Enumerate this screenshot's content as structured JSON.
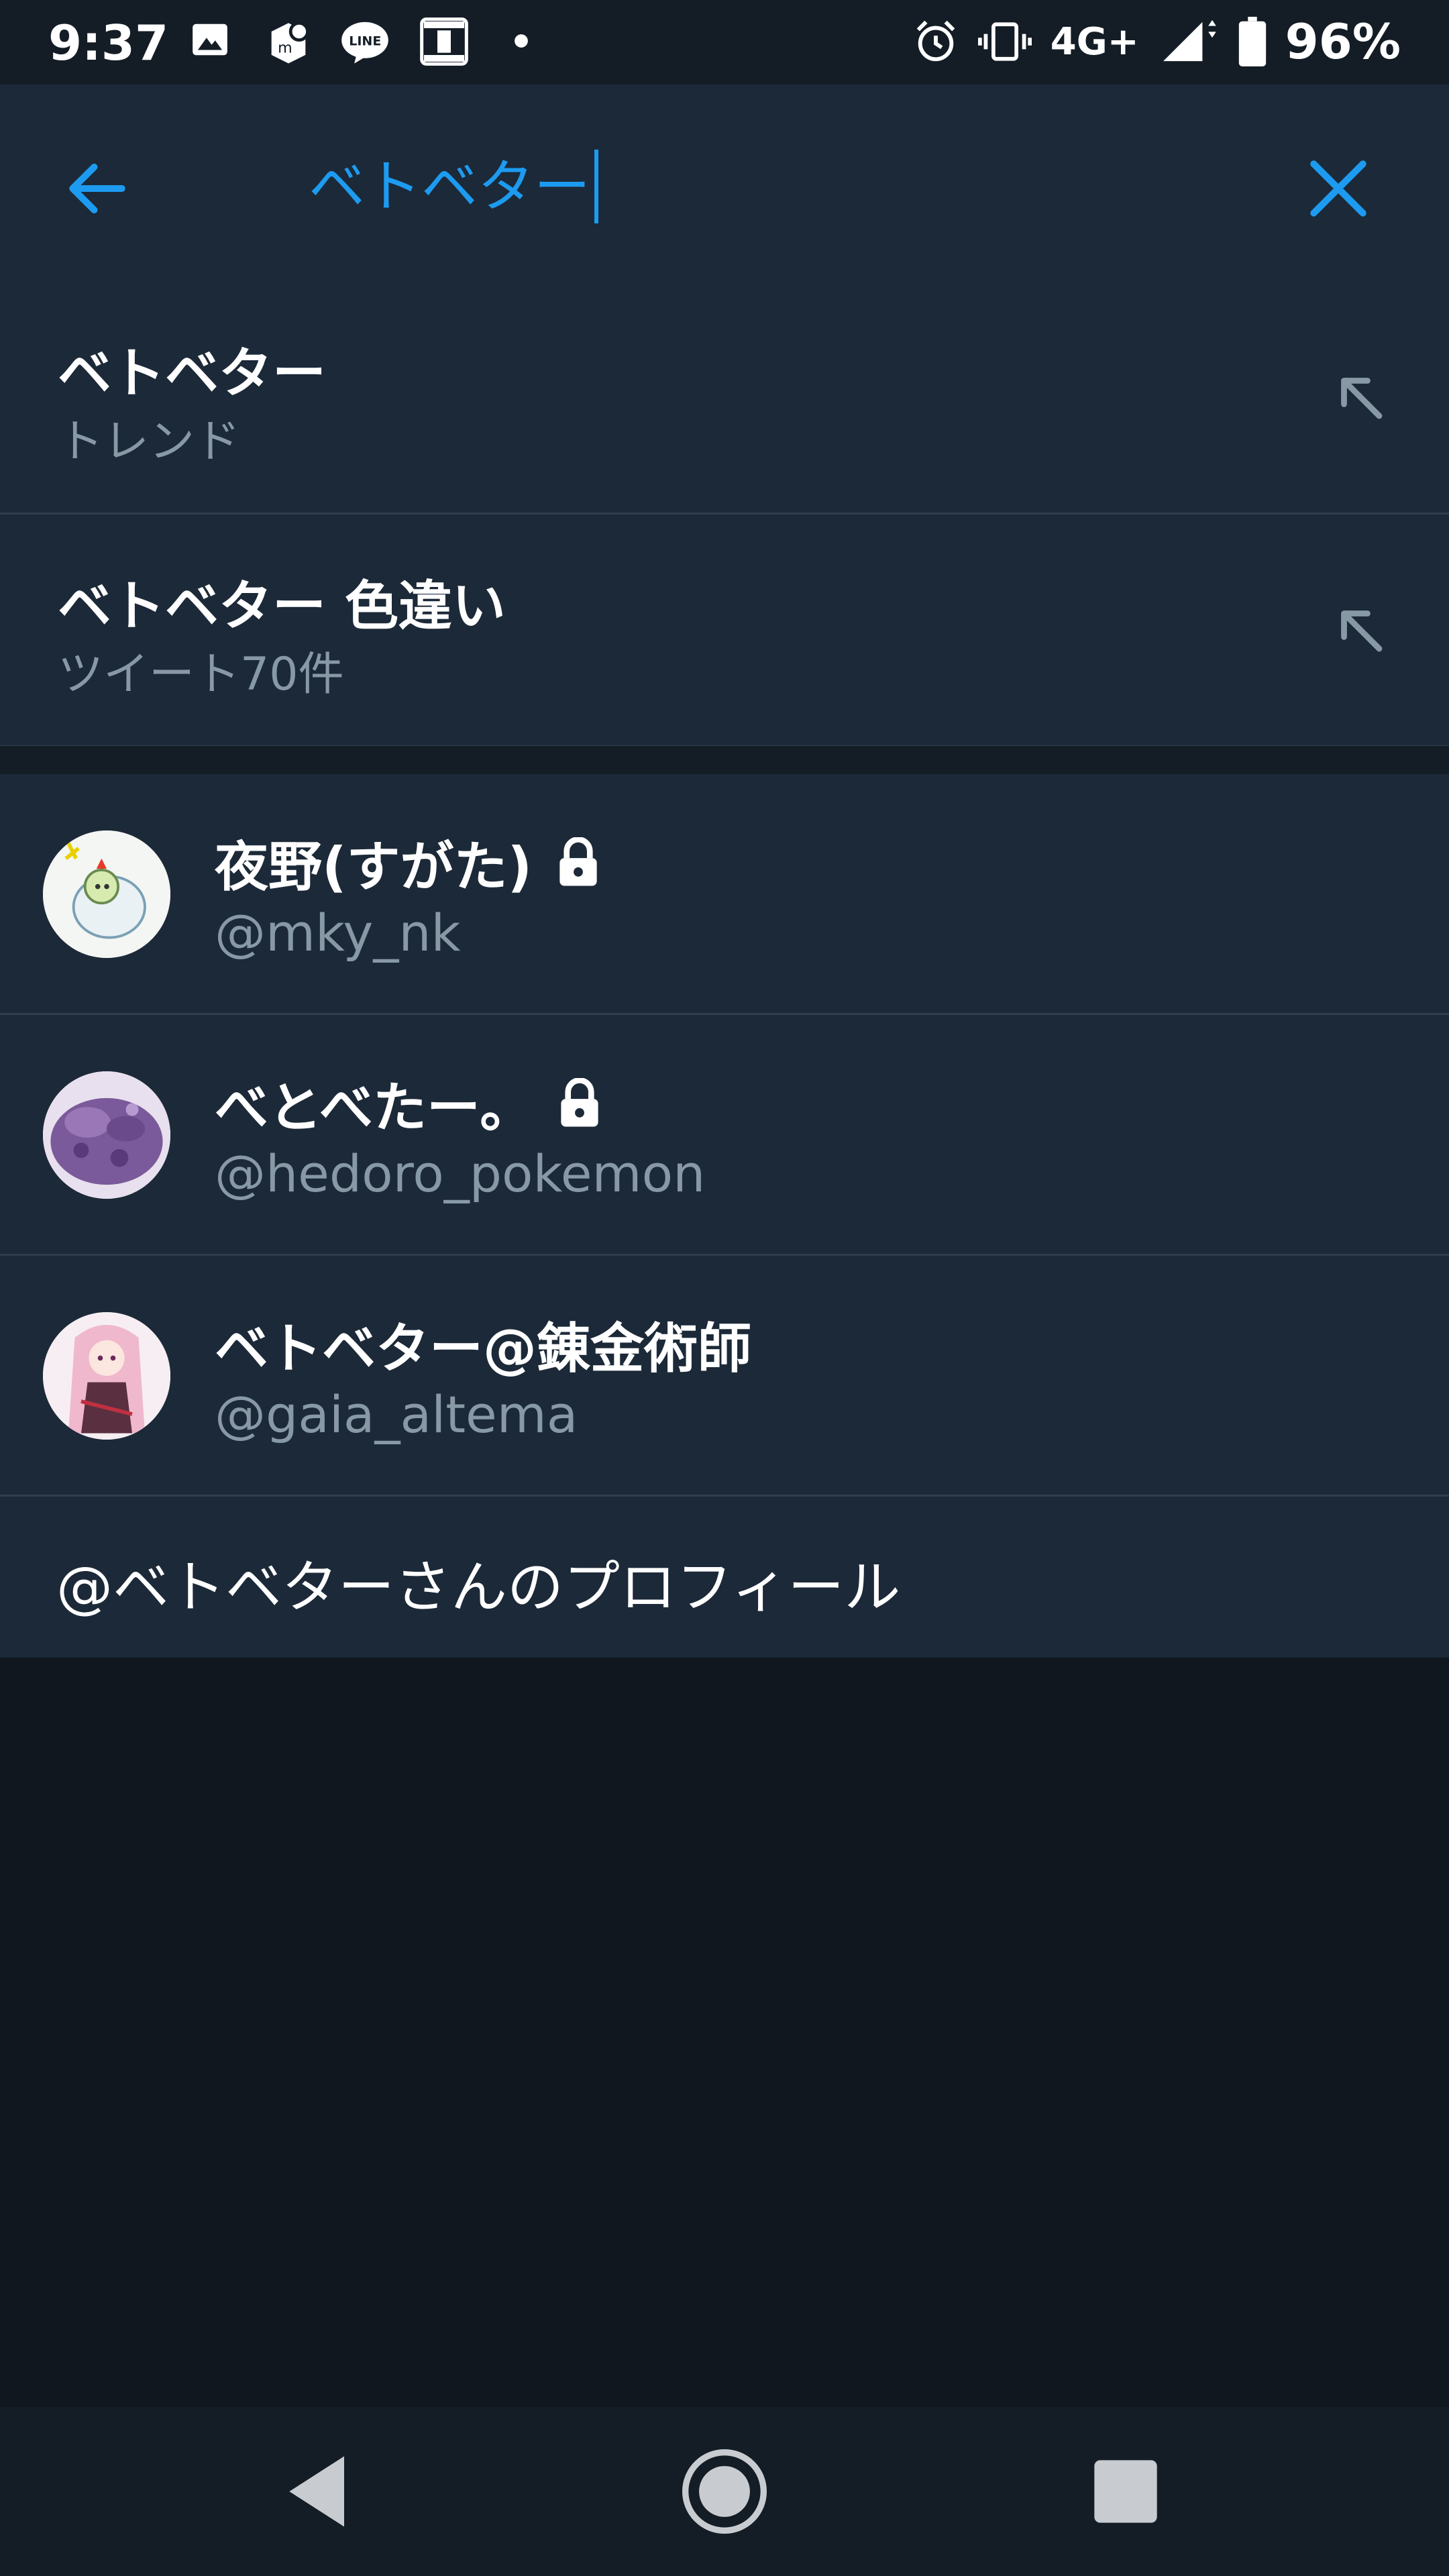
{
  "status_bar": {
    "time": "9:37",
    "network": "4G+",
    "battery": "96%",
    "left_icons": [
      "image-icon",
      "mercari-icon",
      "line-icon",
      "lawson-station-icon",
      "dot-icon"
    ],
    "right_icons": [
      "alarm-icon",
      "vibrate-icon",
      "signal-icon",
      "battery-icon"
    ]
  },
  "search": {
    "query": "ベトベター",
    "accent_color": "#1d9bf0"
  },
  "suggestions": [
    {
      "title": "ベトベター",
      "subtitle": "トレンド"
    },
    {
      "title": "ベトベター 色違い",
      "subtitle": "ツイート70件"
    }
  ],
  "users": [
    {
      "name": "夜野(すがた)",
      "handle": "@mky_nk",
      "locked": true
    },
    {
      "name": "べとべたー。",
      "handle": "@hedoro_pokemon",
      "locked": true
    },
    {
      "name": "ベトベター@錬金術師",
      "handle": "@gaia_altema",
      "locked": false
    }
  ],
  "profile_link": "@ベトベターさんのプロフィール",
  "nav": [
    "back-nav-icon",
    "home-nav-icon",
    "recents-nav-icon"
  ]
}
